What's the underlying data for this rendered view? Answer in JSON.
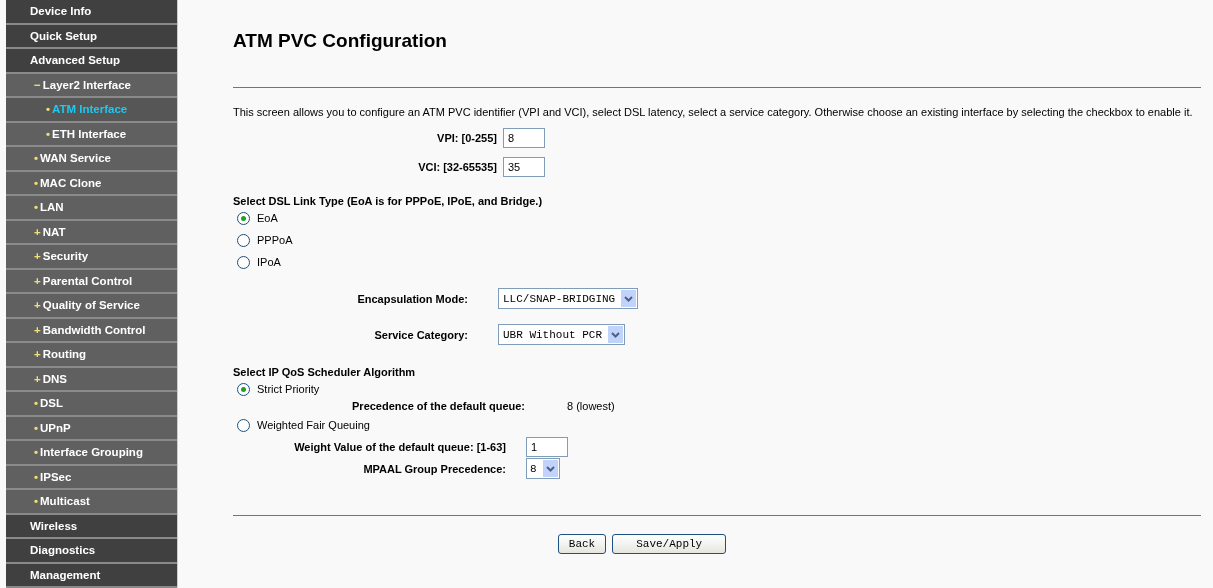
{
  "sidebar": {
    "items": [
      {
        "label": "Device Info",
        "kind": "top",
        "marker": "",
        "selected": false
      },
      {
        "label": "Quick Setup",
        "kind": "top",
        "marker": "",
        "selected": false
      },
      {
        "label": "Advanced Setup",
        "kind": "top",
        "marker": "",
        "selected": false
      },
      {
        "label": "Layer2 Interface",
        "kind": "sub",
        "marker": "−",
        "selected": false
      },
      {
        "label": "ATM Interface",
        "kind": "subsub",
        "marker": "•",
        "selected": true
      },
      {
        "label": "ETH Interface",
        "kind": "subsub",
        "marker": "•",
        "selected": false
      },
      {
        "label": "WAN Service",
        "kind": "sub",
        "marker": "•",
        "selected": false
      },
      {
        "label": "MAC Clone",
        "kind": "sub",
        "marker": "•",
        "selected": false
      },
      {
        "label": "LAN",
        "kind": "sub",
        "marker": "•",
        "selected": false
      },
      {
        "label": "NAT",
        "kind": "sub",
        "marker": "+",
        "selected": false
      },
      {
        "label": "Security",
        "kind": "sub",
        "marker": "+",
        "selected": false
      },
      {
        "label": "Parental Control",
        "kind": "sub",
        "marker": "+",
        "selected": false
      },
      {
        "label": "Quality of Service",
        "kind": "sub",
        "marker": "+",
        "selected": false
      },
      {
        "label": "Bandwidth Control",
        "kind": "sub",
        "marker": "+",
        "selected": false
      },
      {
        "label": "Routing",
        "kind": "sub",
        "marker": "+",
        "selected": false
      },
      {
        "label": "DNS",
        "kind": "sub",
        "marker": "+",
        "selected": false
      },
      {
        "label": "DSL",
        "kind": "sub",
        "marker": "•",
        "selected": false
      },
      {
        "label": "UPnP",
        "kind": "sub",
        "marker": "•",
        "selected": false
      },
      {
        "label": "Interface Grouping",
        "kind": "sub",
        "marker": "•",
        "selected": false
      },
      {
        "label": "IPSec",
        "kind": "sub",
        "marker": "•",
        "selected": false
      },
      {
        "label": "Multicast",
        "kind": "sub",
        "marker": "•",
        "selected": false
      },
      {
        "label": "Wireless",
        "kind": "top",
        "marker": "",
        "selected": false
      },
      {
        "label": "Diagnostics",
        "kind": "top",
        "marker": "",
        "selected": false
      },
      {
        "label": "Management",
        "kind": "top",
        "marker": "",
        "selected": false
      }
    ]
  },
  "title": "ATM PVC Configuration",
  "description": "This screen allows you to configure an ATM PVC identifier (VPI and VCI), select DSL latency, select a service category. Otherwise choose an existing interface by selecting the checkbox to enable it.",
  "id_fields": [
    {
      "label": "VPI: [0-255]",
      "value": "8"
    },
    {
      "label": "VCI: [32-65535]",
      "value": "35"
    }
  ],
  "link_type": {
    "heading": "Select DSL Link Type (EoA is for PPPoE, IPoE, and Bridge.)",
    "options": [
      {
        "label": "EoA",
        "selected": true
      },
      {
        "label": "PPPoA",
        "selected": false
      },
      {
        "label": "IPoA",
        "selected": false
      }
    ]
  },
  "selects": [
    {
      "label": "Encapsulation Mode:",
      "value": "LLC/SNAP-BRIDGING"
    },
    {
      "label": "Service Category:",
      "value": "UBR Without PCR"
    }
  ],
  "scheduler": {
    "heading": "Select IP QoS Scheduler Algorithm",
    "strict": {
      "label": "Strict Priority",
      "selected": true
    },
    "precedence_label": "Precedence of the default queue:",
    "precedence_value": "8 (lowest)",
    "wfq": {
      "label": "Weighted Fair Queuing",
      "selected": false
    },
    "weight_label": "Weight Value of the default queue: [1-63]",
    "weight_value": "1",
    "mpaal_label": "MPAAL Group Precedence:",
    "mpaal_value": "8"
  },
  "buttons": [
    "Back",
    "Save/Apply"
  ]
}
